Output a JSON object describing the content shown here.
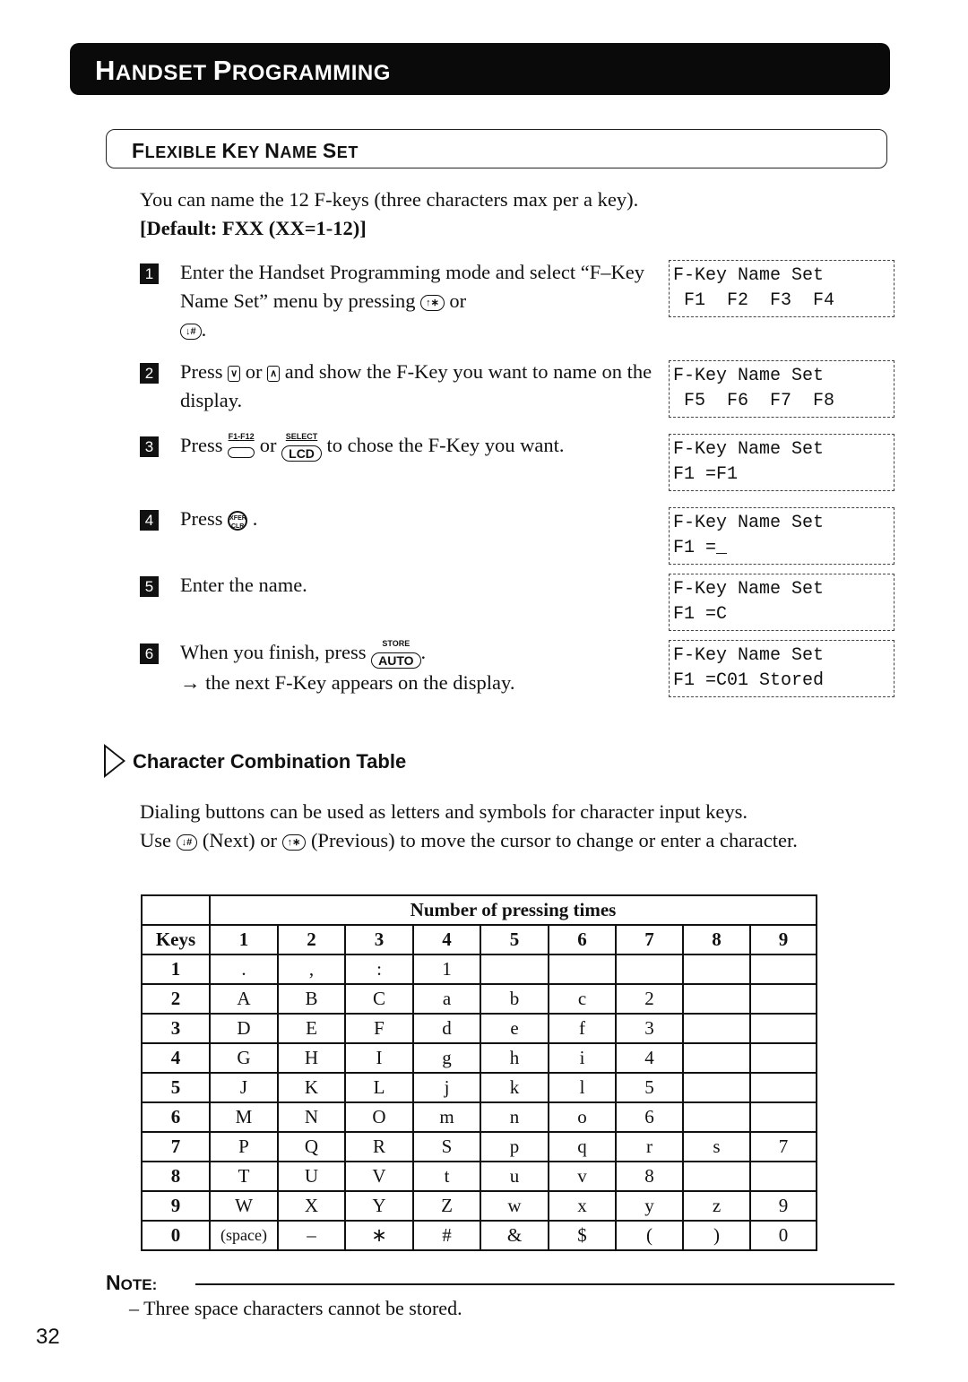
{
  "banner": {
    "title_first_initial": "H",
    "title_first_rest": "ANDSET",
    "title_second_initial": "P",
    "title_second_rest": "ROGRAMMING"
  },
  "section": {
    "words": [
      {
        "initial": "F",
        "rest": "LEXIBLE"
      },
      {
        "initial": "K",
        "rest": "EY"
      },
      {
        "initial": "N",
        "rest": "AME"
      },
      {
        "initial": "S",
        "rest": "ET"
      }
    ]
  },
  "intro": {
    "line1": "You can name the 12 F-keys (three characters max per a key).",
    "default_line": "[Default: FXX (XX=1-12)]"
  },
  "keys": {
    "up_star": "↑∗",
    "down_hash": "↓#",
    "down_arrow": "∨",
    "up_arrow": "∧",
    "f1f12_cap": "F1-F12",
    "select_cap": "SELECT",
    "lcd": "LCD",
    "xfer_clr": "XFER CLR",
    "store_cap": "STORE",
    "auto": "AUTO"
  },
  "steps": [
    {
      "num": "1",
      "a": "Enter the Handset Programming mode and select “F–Key Name Set” menu by pressing",
      "b": "or",
      "c": "."
    },
    {
      "num": "2",
      "a": "Press",
      "b": "or",
      "c": "and show the F-Key you want to name on the display."
    },
    {
      "num": "3",
      "a": "Press",
      "b": "or",
      "c": "to chose the F-Key you want."
    },
    {
      "num": "4",
      "a": "Press",
      "c": "."
    },
    {
      "num": "5",
      "a": "Enter the name."
    },
    {
      "num": "6",
      "a": "When you finish, press",
      "c": ".",
      "d": "→ the next F-Key appears on the display."
    }
  ],
  "lcds": [
    {
      "line1": "F-Key Name Set",
      "line2": " F1  F2  F3  F4"
    },
    {
      "line1": "F-Key Name Set",
      "line2": " F5  F6  F7  F8"
    },
    {
      "line1": "F-Key Name Set",
      "line2": "F1 =F1"
    },
    {
      "line1": "F-Key Name Set",
      "line2": "F1 =_"
    },
    {
      "line1": "F-Key Name Set",
      "line2": "F1 =C"
    },
    {
      "line1": "F-Key Name Set",
      "line2": "F1 =C01 Stored"
    }
  ],
  "subsection": {
    "title": "Character Combination Table",
    "para_1": "Dialing buttons can be used as letters and symbols for character input keys.",
    "para_2a": "Use",
    "para_2b": "(Next) or",
    "para_2c": "(Previous) to move the cursor to change or enter a character."
  },
  "table": {
    "group_header": "Number of pressing times",
    "keys_header": "Keys",
    "columns": [
      "1",
      "2",
      "3",
      "4",
      "5",
      "6",
      "7",
      "8",
      "9"
    ],
    "rows": [
      {
        "key": "1",
        "cells": [
          ".",
          ",",
          ":",
          "1",
          "",
          "",
          "",
          "",
          ""
        ]
      },
      {
        "key": "2",
        "cells": [
          "A",
          "B",
          "C",
          "a",
          "b",
          "c",
          "2",
          "",
          ""
        ]
      },
      {
        "key": "3",
        "cells": [
          "D",
          "E",
          "F",
          "d",
          "e",
          "f",
          "3",
          "",
          ""
        ]
      },
      {
        "key": "4",
        "cells": [
          "G",
          "H",
          "I",
          "g",
          "h",
          "i",
          "4",
          "",
          ""
        ]
      },
      {
        "key": "5",
        "cells": [
          "J",
          "K",
          "L",
          "j",
          "k",
          "l",
          "5",
          "",
          ""
        ]
      },
      {
        "key": "6",
        "cells": [
          "M",
          "N",
          "O",
          "m",
          "n",
          "o",
          "6",
          "",
          ""
        ]
      },
      {
        "key": "7",
        "cells": [
          "P",
          "Q",
          "R",
          "S",
          "p",
          "q",
          "r",
          "s",
          "7"
        ]
      },
      {
        "key": "8",
        "cells": [
          "T",
          "U",
          "V",
          "t",
          "u",
          "v",
          "8",
          "",
          ""
        ]
      },
      {
        "key": "9",
        "cells": [
          "W",
          "X",
          "Y",
          "Z",
          "w",
          "x",
          "y",
          "z",
          "9"
        ]
      },
      {
        "key": "0",
        "cells": [
          "(space)",
          "–",
          "∗",
          "#",
          "&",
          "$",
          "(",
          ")",
          "0"
        ]
      }
    ]
  },
  "note": {
    "initial": "N",
    "rest": "OTE:",
    "text": "– Three space characters cannot be stored."
  },
  "page_number": "32"
}
